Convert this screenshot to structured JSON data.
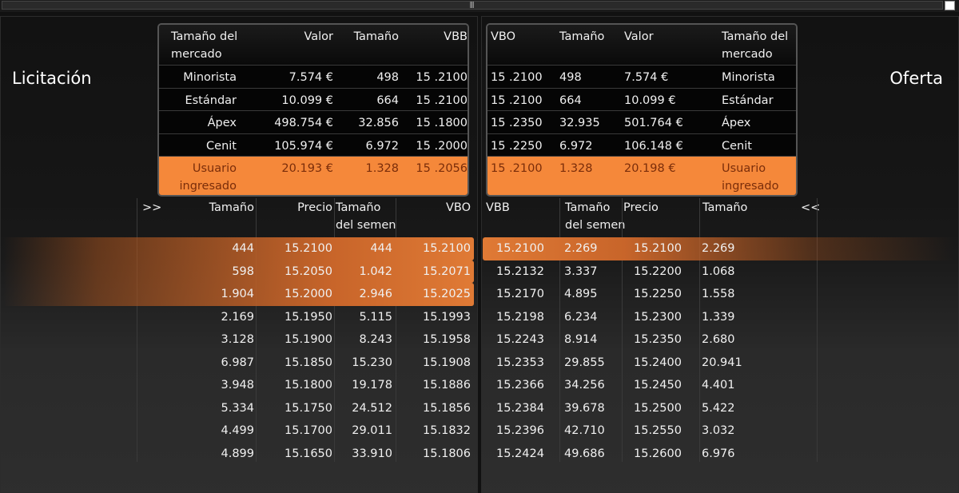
{
  "topbar": {
    "grip": "|||"
  },
  "bid_title": "Licitación",
  "ask_title": "Oferta",
  "bid_market": {
    "headers": [
      "Tamaño del\nmercado",
      "Valor",
      "Tamaño",
      "VBB"
    ],
    "rows": [
      [
        "Minorista",
        "7.574 €",
        "498",
        "15 .2100"
      ],
      [
        "Estándar",
        "10.099 €",
        "664",
        "15 .2100"
      ],
      [
        "Ápex",
        "498.754 €",
        "32.856",
        "15 .1800"
      ],
      [
        "Cenit",
        "105.974 €",
        "6.972",
        "15 .2000"
      ]
    ],
    "user_row": [
      "Usuario\ningresado",
      "20.193 €",
      "1.328",
      "15 .2056"
    ]
  },
  "ask_market": {
    "headers": [
      "VBO",
      "Tamaño",
      "Valor",
      "Tamaño del\nmercado"
    ],
    "rows": [
      [
        "15 .2100",
        "498",
        "7.574 €",
        "Minorista"
      ],
      [
        "15 .2100",
        "664",
        "10.099 €",
        "Estándar"
      ],
      [
        "15 .2350",
        "32.935",
        "501.764 €",
        "Ápex"
      ],
      [
        "15 .2250",
        "6.972",
        "106.148 €",
        "Cenit"
      ]
    ],
    "user_row": [
      "15 .2100",
      "1.328",
      "20.198 €",
      "Usuario\ningresado"
    ]
  },
  "bid_book": {
    "expand": ">>",
    "headers": [
      "Tamaño",
      "Precio",
      "Tamaño\ndel semen",
      "VBO"
    ],
    "rows": [
      [
        "444",
        "15.2100",
        "444",
        "15.2100"
      ],
      [
        "598",
        "15.2050",
        "1.042",
        "15.2071"
      ],
      [
        "1.904",
        "15.2000",
        "2.946",
        "15.2025"
      ],
      [
        "2.169",
        "15.1950",
        "5.115",
        "15.1993"
      ],
      [
        "3.128",
        "15.1900",
        "8.243",
        "15.1958"
      ],
      [
        "6.987",
        "15.1850",
        "15.230",
        "15.1908"
      ],
      [
        "3.948",
        "15.1800",
        "19.178",
        "15.1886"
      ],
      [
        "5.334",
        "15.1750",
        "24.512",
        "15.1856"
      ],
      [
        "4.499",
        "15.1700",
        "29.011",
        "15.1832"
      ],
      [
        "4.899",
        "15.1650",
        "33.910",
        "15.1806"
      ]
    ]
  },
  "ask_book": {
    "collapse": "<<",
    "headers": [
      "VBB",
      "Tamaño\ndel semen",
      "Precio",
      "Tamaño"
    ],
    "rows": [
      [
        "15.2100",
        "2.269",
        "15.2100",
        "2.269"
      ],
      [
        "15.2132",
        "3.337",
        "15.2200",
        "1.068"
      ],
      [
        "15.2170",
        "4.895",
        "15.2250",
        "1.558"
      ],
      [
        "15.2198",
        "6.234",
        "15.2300",
        "1.339"
      ],
      [
        "15.2243",
        "8.914",
        "15.2350",
        "2.680"
      ],
      [
        "15.2353",
        "29.855",
        "15.2400",
        "20.941"
      ],
      [
        "15.2366",
        "34.256",
        "15.2450",
        "4.401"
      ],
      [
        "15.2384",
        "39.678",
        "15.2500",
        "5.422"
      ],
      [
        "15.2396",
        "42.710",
        "15.2550",
        "3.032"
      ],
      [
        "15.2424",
        "49.686",
        "15.2600",
        "6.976"
      ]
    ]
  },
  "colors": {
    "highlight": "#f5883a",
    "background": "#111111"
  }
}
